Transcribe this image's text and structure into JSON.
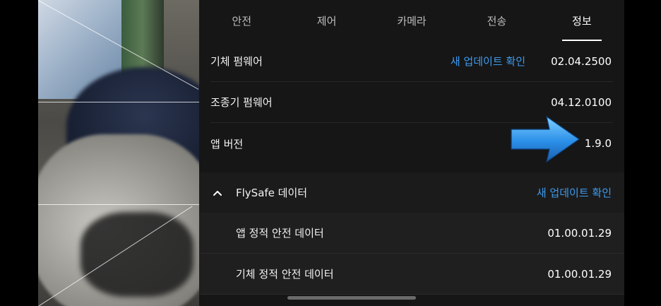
{
  "tabs": [
    {
      "label": "안전"
    },
    {
      "label": "제어"
    },
    {
      "label": "카메라"
    },
    {
      "label": "전송"
    },
    {
      "label": "정보"
    }
  ],
  "active_tab": "정보",
  "rows": {
    "aircraft_firmware": {
      "label": "기체 펌웨어",
      "link": "새 업데이트 확인",
      "value": "02.04.2500"
    },
    "controller_firmware": {
      "label": "조종기 펌웨어",
      "value": "04.12.0100"
    },
    "app_version": {
      "label": "앱 버전",
      "value": "1.9.0"
    }
  },
  "flysafe": {
    "title": "FlySafe 데이터",
    "link": "새 업데이트 확인",
    "expanded": true,
    "items": [
      {
        "label": "앱 정적 안전 데이터",
        "value": "01.00.01.29"
      },
      {
        "label": "기체 정적 안전 데이터",
        "value": "01.00.01.29"
      }
    ]
  },
  "colors": {
    "link": "#3d9bf0",
    "arrow": "#2b8fe8",
    "panel_bg": "#161616"
  },
  "icons": {
    "chevron": "chevron-up-icon",
    "annotation": "blue-arrow-icon"
  }
}
